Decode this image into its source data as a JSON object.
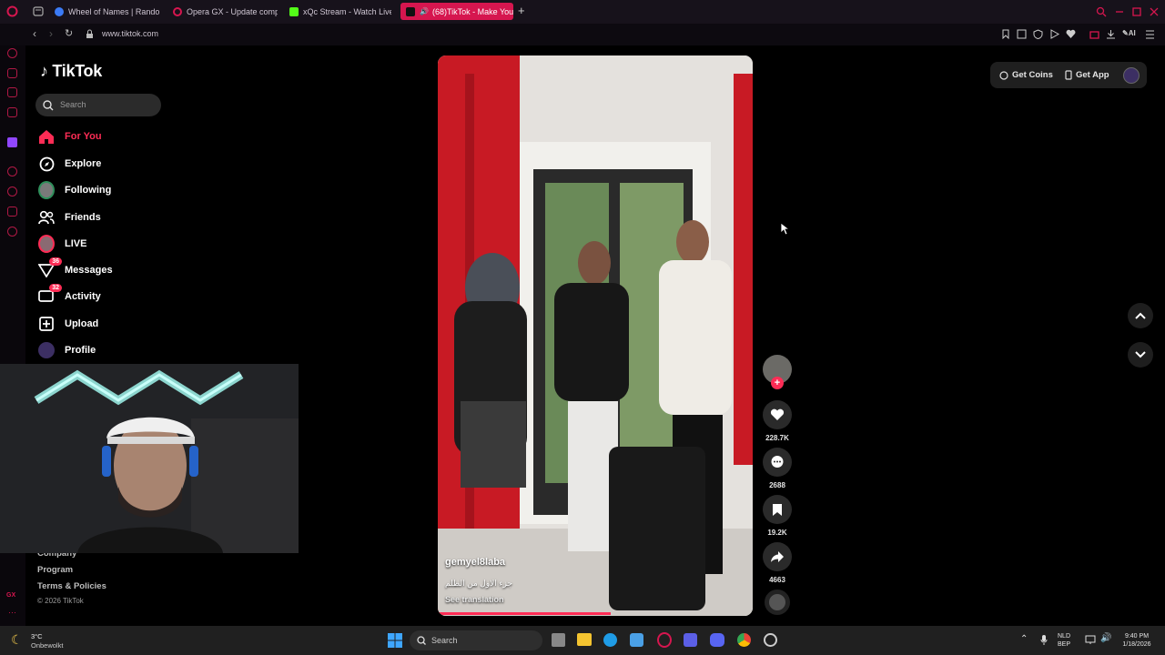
{
  "browser": {
    "tabs": [
      {
        "label": "Wheel of Names | Random",
        "color": "#3b7bf6"
      },
      {
        "label": "Opera GX - Update comp",
        "color": "#d6164f"
      },
      {
        "label": "xQc Stream - Watch Live",
        "color": "#53fc18"
      },
      {
        "label": "(68)TikTok - Make You",
        "color": "#ffffff"
      }
    ],
    "url": "www.tiktok.com",
    "ai_label": "AI"
  },
  "tiktok": {
    "logo": "TikTok",
    "search_placeholder": "Search",
    "nav": [
      {
        "label": "For You",
        "icon": "home-icon"
      },
      {
        "label": "Explore",
        "icon": "compass-icon"
      },
      {
        "label": "Following",
        "icon": "following-avatar"
      },
      {
        "label": "Friends",
        "icon": "friends-icon"
      },
      {
        "label": "LIVE",
        "icon": "live-avatar"
      },
      {
        "label": "Messages",
        "icon": "messages-icon",
        "badge": "36"
      },
      {
        "label": "Activity",
        "icon": "activity-icon",
        "badge": "32"
      },
      {
        "label": "Upload",
        "icon": "upload-icon"
      },
      {
        "label": "Profile",
        "icon": "profile-avatar"
      }
    ],
    "footer": {
      "company": "Company",
      "program": "Program",
      "terms": "Terms & Policies",
      "copyright": "© 2026 TikTok"
    },
    "top_buttons": {
      "coins": "Get Coins",
      "app": "Get App"
    },
    "video": {
      "author": "gemyel8laba",
      "caption": "جزء الاول من الظلم",
      "translate": "See translation"
    },
    "actions": {
      "likes": "228.7K",
      "comments": "2688",
      "saves": "19.2K",
      "shares": "4663"
    }
  },
  "taskbar": {
    "weather_temp": "3°C",
    "weather_desc": "Onbewolkt",
    "search": "Search",
    "lang_top": "NLD",
    "lang_bottom": "BEP",
    "time": "9:40 PM",
    "date": "1/18/2026"
  },
  "opera_sidebar": {
    "gx_label": "GX"
  }
}
